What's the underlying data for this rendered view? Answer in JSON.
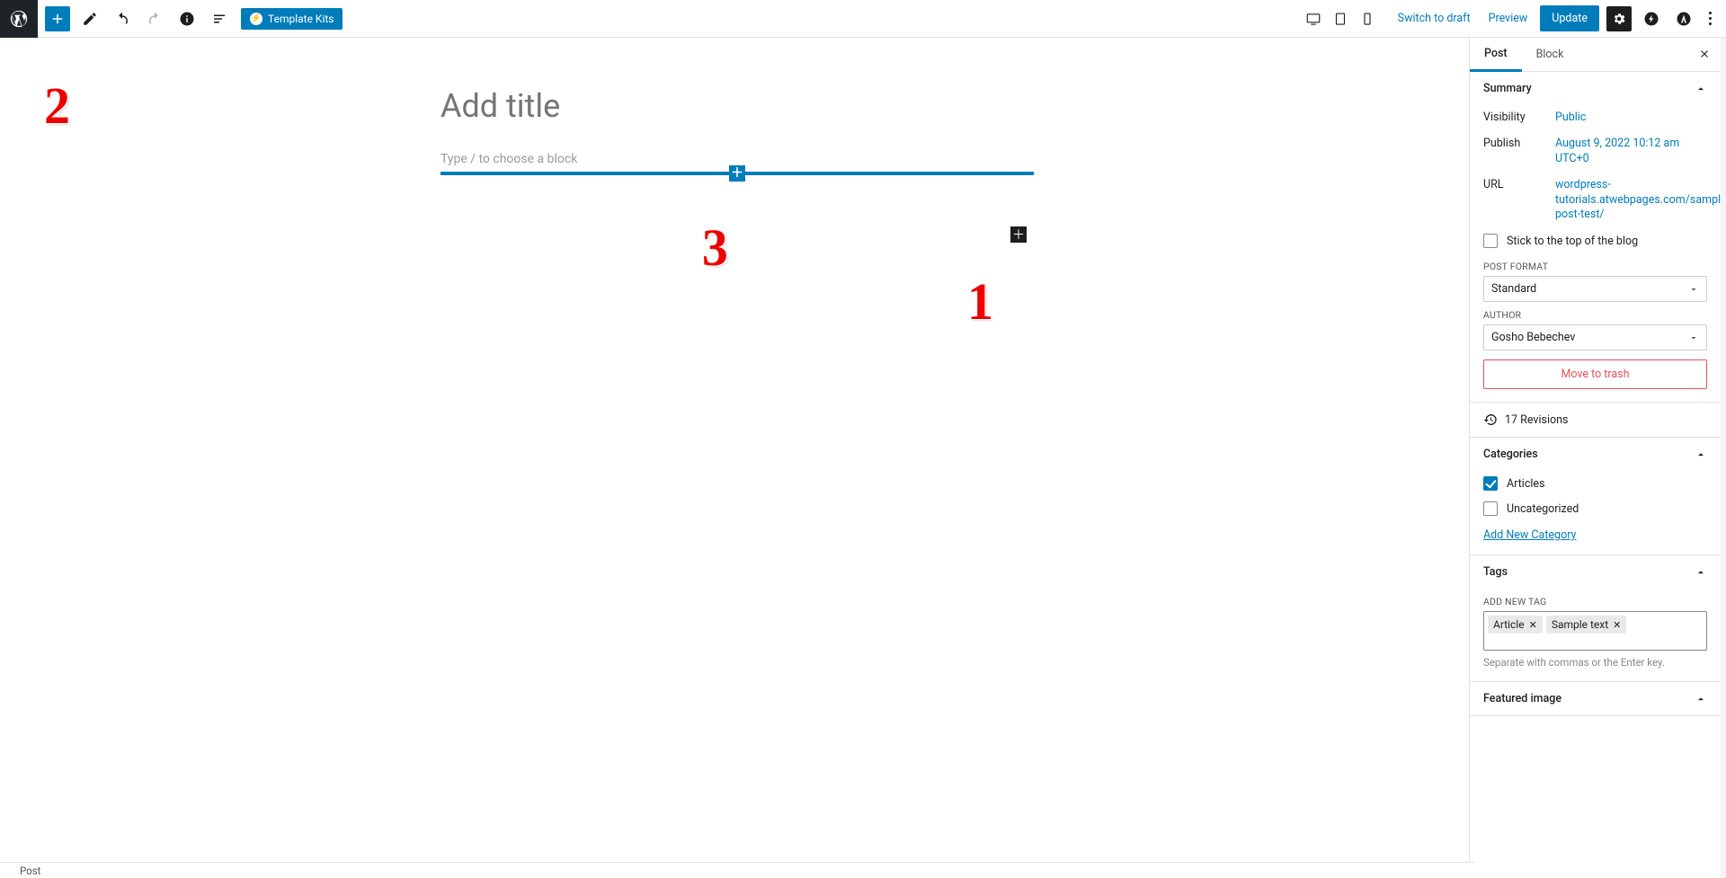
{
  "topbar": {
    "template_kits_label": "Template Kits",
    "switch_to_draft": "Switch to draft",
    "preview": "Preview",
    "update": "Update"
  },
  "editor": {
    "title_placeholder": "Add title",
    "block_placeholder": "Type / to choose a block"
  },
  "annotations": {
    "n1": "1",
    "n2": "2",
    "n3": "3"
  },
  "sidebar": {
    "tabs": {
      "post": "Post",
      "block": "Block"
    },
    "summary": {
      "heading": "Summary",
      "visibility": {
        "lbl": "Visibility",
        "val": "Public"
      },
      "publish": {
        "lbl": "Publish",
        "val": "August 9, 2022 10:12 am UTC+0"
      },
      "url": {
        "lbl": "URL",
        "val": "wordpress-tutorials.atwebpages.com/sample-post-test/"
      },
      "stick_label": "Stick to the top of the blog",
      "post_format_label": "POST FORMAT",
      "post_format_value": "Standard",
      "author_label": "AUTHOR",
      "author_value": "Gosho Bebechev",
      "move_to_trash": "Move to trash"
    },
    "revisions": {
      "label": "17 Revisions"
    },
    "categories": {
      "heading": "Categories",
      "items": [
        {
          "label": "Articles",
          "checked": true
        },
        {
          "label": "Uncategorized",
          "checked": false
        }
      ],
      "add_link": "Add New Category"
    },
    "tags": {
      "heading": "Tags",
      "add_label": "ADD NEW TAG",
      "chips": [
        "Article",
        "Sample text"
      ],
      "hint": "Separate with commas or the Enter key."
    },
    "featured_image": {
      "heading": "Featured image"
    }
  },
  "breadcrumb": "Post"
}
